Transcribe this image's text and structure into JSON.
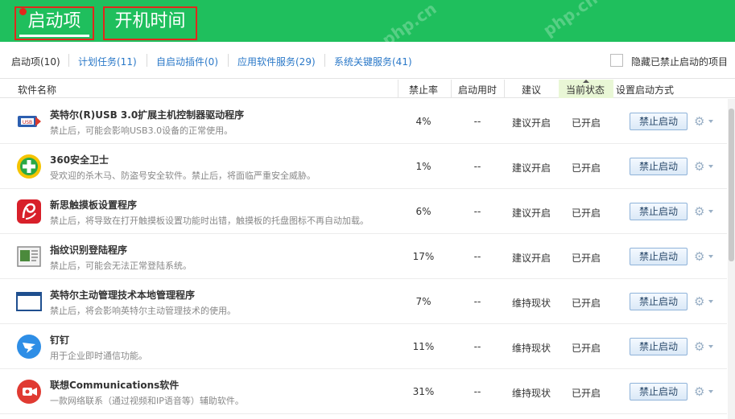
{
  "header": {
    "tab_boot": "启动项",
    "tab_time": "开机时间",
    "watermarks": [
      "php.cn",
      "php.cn"
    ]
  },
  "filters": {
    "items": [
      {
        "label": "启动项(10)",
        "active": true
      },
      {
        "label": "计划任务(11)",
        "active": false
      },
      {
        "label": "自启动插件(0)",
        "active": false
      },
      {
        "label": "应用软件服务(29)",
        "active": false
      },
      {
        "label": "系统关键服务(41)",
        "active": false
      }
    ],
    "hide_label": "隐藏已禁止启动的项目"
  },
  "columns": {
    "name": "软件名称",
    "rate": "禁止率",
    "time": "启动用时",
    "advice": "建议",
    "state": "当前状态",
    "method": "设置启动方式"
  },
  "rows": [
    {
      "name": "英特尔(R)USB 3.0扩展主机控制器驱动程序",
      "desc": "禁止后，可能会影响USB3.0设备的正常使用。",
      "rate": "4%",
      "time": "--",
      "advice": "建议开启",
      "state": "已开启",
      "button": "禁止启动",
      "icon": "usb-driver-icon"
    },
    {
      "name": "360安全卫士",
      "desc": "受欢迎的杀木马、防盗号安全软件。禁止后，将面临严重安全威胁。",
      "rate": "1%",
      "time": "--",
      "advice": "建议开启",
      "state": "已开启",
      "button": "禁止启动",
      "icon": "360-security-icon"
    },
    {
      "name": "新思触摸板设置程序",
      "desc": "禁止后，将导致在打开触摸板设置功能时出错，触摸板的托盘图标不再自动加载。",
      "rate": "6%",
      "time": "--",
      "advice": "建议开启",
      "state": "已开启",
      "button": "禁止启动",
      "icon": "synaptics-icon"
    },
    {
      "name": "指纹识别登陆程序",
      "desc": "禁止后，可能会无法正常登陆系统。",
      "rate": "17%",
      "time": "--",
      "advice": "建议开启",
      "state": "已开启",
      "button": "禁止启动",
      "icon": "fingerprint-app-icon"
    },
    {
      "name": "英特尔主动管理技术本地管理程序",
      "desc": "禁止后，将会影响英特尔主动管理技术的使用。",
      "rate": "7%",
      "time": "--",
      "advice": "维持现状",
      "state": "已开启",
      "button": "禁止启动",
      "icon": "intel-amt-icon"
    },
    {
      "name": "钉钉",
      "desc": "用于企业即时通信功能。",
      "rate": "11%",
      "time": "--",
      "advice": "维持现状",
      "state": "已开启",
      "button": "禁止启动",
      "icon": "dingtalk-icon"
    },
    {
      "name": "联想Communications软件",
      "desc": "一款网络联系（通过视频和IP语音等）辅助软件。",
      "rate": "31%",
      "time": "--",
      "advice": "维持现状",
      "state": "已开启",
      "button": "禁止启动",
      "icon": "lenovo-communications-icon"
    }
  ],
  "colors": {
    "header_green": "#1fbf5d",
    "link_blue": "#2a78c8",
    "highlight_red": "#e0281c"
  }
}
